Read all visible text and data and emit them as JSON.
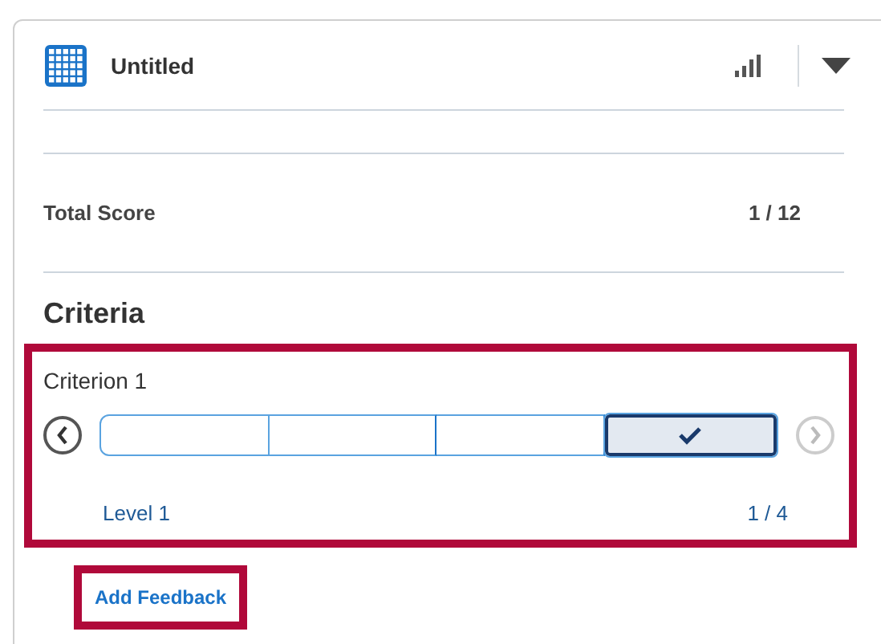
{
  "header": {
    "title": "Untitled"
  },
  "total_score": {
    "label": "Total Score",
    "value": "1 / 12"
  },
  "criteria": {
    "heading": "Criteria",
    "highlighted": true,
    "items": [
      {
        "name": "Criterion 1",
        "prev_disabled": false,
        "next_disabled": true,
        "level_name": "Level 1",
        "position": "1 / 4",
        "levels": [
          {
            "selected": false
          },
          {
            "selected": false
          },
          {
            "selected": false
          },
          {
            "selected": true
          }
        ]
      }
    ]
  },
  "add_feedback": {
    "label": "Add Feedback",
    "highlighted": true
  }
}
